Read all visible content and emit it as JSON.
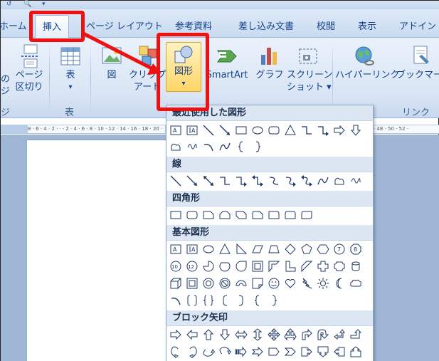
{
  "tabs": [
    {
      "label": "ホーム",
      "active": false
    },
    {
      "label": "挿入",
      "active": true
    },
    {
      "label": "ページ レイアウト",
      "active": false
    },
    {
      "label": "参考資料",
      "active": false
    },
    {
      "label": "差し込み文書",
      "active": false
    },
    {
      "label": "校閲",
      "active": false
    },
    {
      "label": "表示",
      "active": false
    },
    {
      "label": "アドイン",
      "active": false
    }
  ],
  "ribbon": {
    "page_break": {
      "line1": "ページ",
      "line2": "区切り"
    },
    "partial_left": {
      "line1": "の",
      "line2": "ジ",
      "line3": "ジ"
    },
    "table": {
      "label": "表",
      "arrow": "▾"
    },
    "picture": {
      "label": "図"
    },
    "clipart": {
      "line1": "クリップ",
      "line2": "アート"
    },
    "shapes": {
      "label": "図形",
      "arrow": "▾"
    },
    "smartart": {
      "label": "SmartArt"
    },
    "chart": {
      "label": "グラフ"
    },
    "screenshot": {
      "line1": "スクリーン",
      "line2": "ショット ▾"
    },
    "hyperlink": {
      "label": "ハイパーリンク"
    },
    "bookmark": {
      "label": "ブックマーク"
    },
    "groups": {
      "table": "表",
      "links": "リンク"
    }
  },
  "ruler": {
    "text": "8 · 6 · 4 · 2 · · · 2 · 4 · 6 · 8 · 10 · 12 · 14 · 16 · 18 · 20 ·",
    "right_text": "· 48 · 50 · 52 ·"
  },
  "dropdown": {
    "sections": [
      {
        "title": "最近使用した図形"
      },
      {
        "title": "線"
      },
      {
        "title": "四角形"
      },
      {
        "title": "基本図形"
      },
      {
        "title": "ブロック矢印"
      }
    ]
  },
  "shape_text": {
    "A": "A",
    "n7": "7",
    "n8": "8",
    "n10": "10",
    "n12": "12"
  },
  "colors": {
    "highlight": "#ee1111",
    "ribbon": "#dae6f5",
    "accent": "#15428b"
  }
}
